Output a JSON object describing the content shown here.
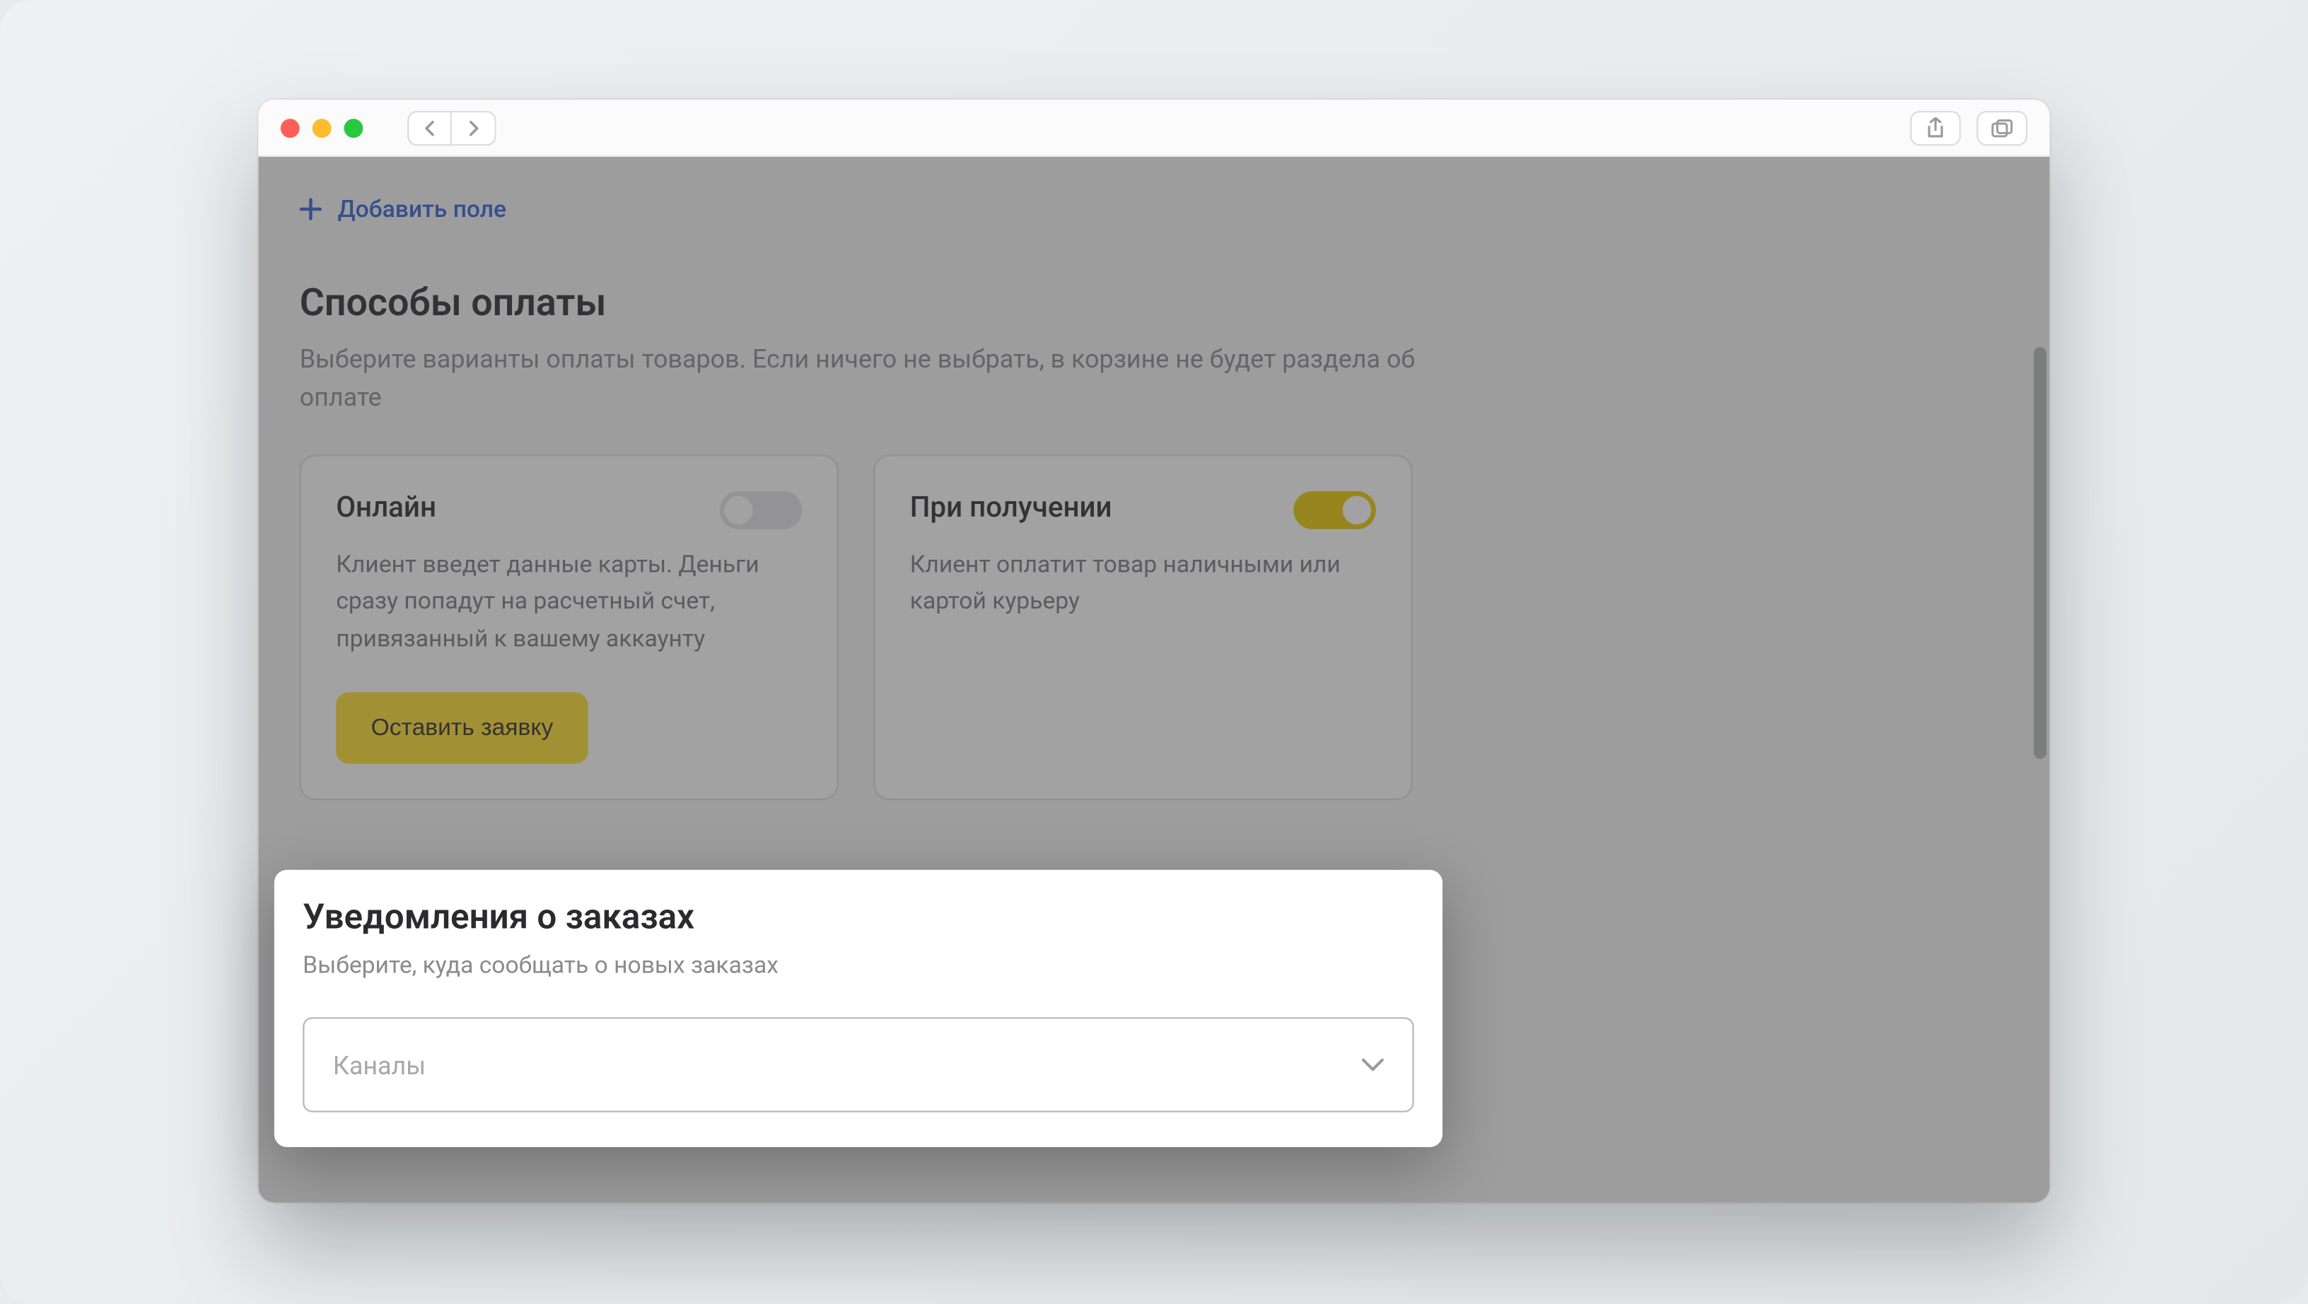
{
  "addField": {
    "label": "Добавить поле"
  },
  "payment": {
    "title": "Способы оплаты",
    "subtitle": "Выберите варианты оплаты товаров. Если ничего не выбрать, в корзине не будет раздела об оплате",
    "online": {
      "title": "Онлайн",
      "desc": "Клиент введет данные карты. Деньги сразу попадут на расчетный счет, привязанный к вашему аккаунту",
      "cta": "Оставить заявку"
    },
    "onDelivery": {
      "title": "При получении",
      "desc": "Клиент оплатит товар наличными или картой курьеру"
    }
  },
  "notifications": {
    "title": "Уведомления о заказах",
    "subtitle": "Выберите, куда сообщать о новых заказах",
    "selectPlaceholder": "Каналы"
  }
}
